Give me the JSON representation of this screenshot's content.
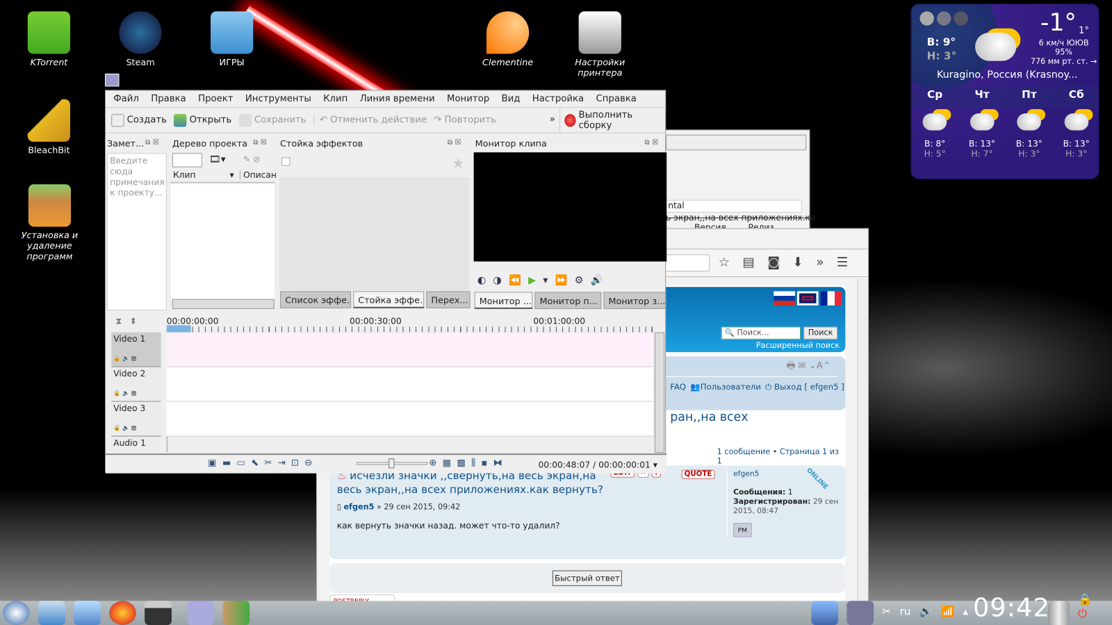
{
  "desktop": {
    "icons": [
      {
        "label": "KTorrent"
      },
      {
        "label": "Steam"
      },
      {
        "label": "ИГРЫ"
      },
      {
        "label": "Clementine"
      },
      {
        "label": "Настройки принтера"
      },
      {
        "label": "BleachBit"
      },
      {
        "label": "Установка и удаление программ"
      }
    ]
  },
  "weather": {
    "temp": "-1°",
    "feels": "1°",
    "high": "В: 9°",
    "low": "Н: 3°",
    "wind": "6 км/ч ЮЮВ",
    "humidity": "95%",
    "pressure": "776 мм рт. ст. →",
    "location": "Kuragino, Россия (Krasnoy...",
    "days": [
      {
        "name": "Ср",
        "high": "В: 8°",
        "low": "Н: 5°"
      },
      {
        "name": "Чт",
        "high": "В: 13°",
        "low": "Н: 7°"
      },
      {
        "name": "Пт",
        "high": "В: 13°",
        "low": "Н: 3°"
      },
      {
        "name": "Сб",
        "high": "В: 13°",
        "low": "Н: 3°"
      }
    ]
  },
  "kdenlive": {
    "menu": [
      "Файл",
      "Правка",
      "Проект",
      "Инструменты",
      "Клип",
      "Линия времени",
      "Монитор",
      "Вид",
      "Настройка",
      "Справка"
    ],
    "toolbar": {
      "create": "Создать",
      "open": "Открыть",
      "save": "Сохранить",
      "undo": "Отменить действие",
      "redo": "Повторить",
      "more": "»",
      "render": "Выполнить сборку"
    },
    "notes": {
      "title": "Замет...",
      "placeholder": "Введите сюда примечания к проекту..."
    },
    "project_tree": {
      "title": "Дерево проекта",
      "col_clip": "Клип",
      "col_desc": "Описан"
    },
    "effect_stack": {
      "title": "Стойка эффектов"
    },
    "clip_monitor": {
      "title": "Монитор клипа"
    },
    "effect_tabs": [
      "Список эффе...",
      "Стойка эффе...",
      "Перех..."
    ],
    "monitor_tabs": [
      "Монитор ...",
      "Монитор п...",
      "Монитор з..."
    ],
    "ruler": [
      "00:00:00:00",
      "00:00:30:00",
      "00:01:00:00"
    ],
    "tracks": [
      "Video 1",
      "Video 2",
      "Video 3",
      "Audio 1"
    ],
    "timecode": "00:00:48:07 / 00:00:00:01"
  },
  "bg_window": {
    "field_text": "ntal",
    "overflow_text": "ь экран,,на всех приложениях.как",
    "col1": "Версия",
    "col2": "Релиз"
  },
  "forum": {
    "search_placeholder": "Поиск...",
    "search_btn": "Поиск",
    "adv_search": "Расширенный поиск",
    "nav_partial": ")",
    "faq": "FAQ",
    "users": "Пользователи",
    "logout": "Выход [ efgen5 ]",
    "title_partial": "ран,,на всех",
    "pagination": "1 сообщение • Страница 1 из 1",
    "post": {
      "title": "исчезли значки ,,свернуть,на весь экран,на весь экран,,на всех приложениях.как вернуть?",
      "author": "efgen5",
      "date": "» 29 сен 2015, 09:42",
      "body": "как вернуть значки назад. может что-то удалил?",
      "edit": "EDIT",
      "quote": "QUOTE",
      "online": "ONLINE",
      "profile": {
        "name": "efgen5",
        "posts_label": "Сообщения:",
        "posts": "1",
        "reg_label": "Зарегистрирован:",
        "reg": "29 сен 2015, 08:47",
        "pm": "PM"
      }
    },
    "quick_reply": "Быстрый ответ",
    "postreply": "POSTREPLY"
  },
  "taskbar": {
    "lang": "ru",
    "clock": "09:42"
  }
}
